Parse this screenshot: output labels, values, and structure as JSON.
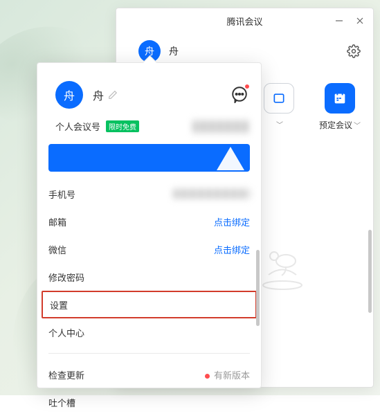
{
  "window": {
    "title": "腾讯会议"
  },
  "header": {
    "avatar_char": "舟",
    "username": "舟"
  },
  "actions": {
    "hidden_label": "",
    "schedule_label": "预定会议"
  },
  "popover": {
    "avatar_char": "舟",
    "username": "舟",
    "meeting_id_label": "个人会议号",
    "badge": "限时免费",
    "items": {
      "phone": {
        "label": "手机号"
      },
      "email": {
        "label": "邮箱",
        "action": "点击绑定"
      },
      "wechat": {
        "label": "微信",
        "action": "点击绑定"
      },
      "change_pwd": {
        "label": "修改密码"
      },
      "settings": {
        "label": "设置"
      },
      "profile_center": {
        "label": "个人中心"
      },
      "check_update": {
        "label": "检查更新",
        "status": "有新版本"
      },
      "feedback": {
        "label": "吐个槽"
      }
    }
  }
}
